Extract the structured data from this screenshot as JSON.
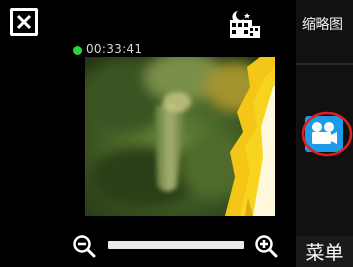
{
  "toolbar": {
    "close_icon": "close-icon",
    "mode_icon": "night-mode-icon",
    "thumbnail_label": "缩略图"
  },
  "recording": {
    "status_color": "#2fd43a",
    "elapsed_time": "00:33:41"
  },
  "zoom": {
    "zoom_out_icon": "zoom-out-icon",
    "zoom_in_icon": "zoom-in-icon"
  },
  "side_panel": {
    "video_mode_icon": "video-camera-icon",
    "video_mode_color": "#1e9be8",
    "highlight_color": "#e02020",
    "menu_label": "菜单"
  }
}
